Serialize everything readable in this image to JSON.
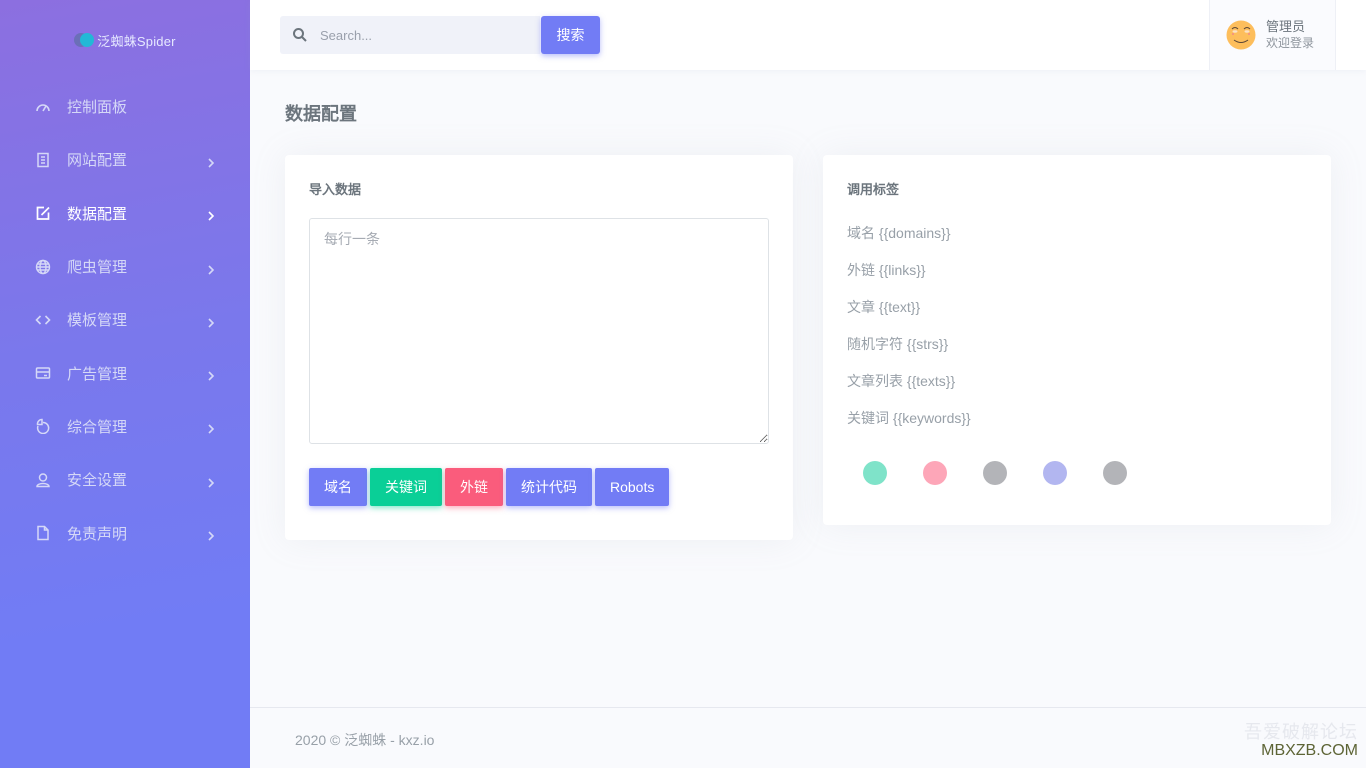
{
  "brand": {
    "name": "泛蜘蛛Spider"
  },
  "sidebar": {
    "items": [
      {
        "label": "控制面板",
        "icon": "speedometer-icon",
        "has_chevron": false,
        "active": false
      },
      {
        "label": "网站配置",
        "icon": "document-list-icon",
        "has_chevron": true,
        "active": false
      },
      {
        "label": "数据配置",
        "icon": "edit-icon",
        "has_chevron": true,
        "active": true
      },
      {
        "label": "爬虫管理",
        "icon": "globe-icon",
        "has_chevron": true,
        "active": false
      },
      {
        "label": "模板管理",
        "icon": "code-icon",
        "has_chevron": true,
        "active": false
      },
      {
        "label": "广告管理",
        "icon": "card-icon",
        "has_chevron": true,
        "active": false
      },
      {
        "label": "综合管理",
        "icon": "pie-chart-icon",
        "has_chevron": true,
        "active": false
      },
      {
        "label": "安全设置",
        "icon": "user-icon",
        "has_chevron": true,
        "active": false
      },
      {
        "label": "免责声明",
        "icon": "file-icon",
        "has_chevron": true,
        "active": false
      }
    ]
  },
  "topbar": {
    "search": {
      "placeholder": "Search...",
      "value": "",
      "button_label": "搜索"
    },
    "user": {
      "name": "管理员",
      "subtitle": "欢迎登录"
    }
  },
  "page": {
    "title": "数据配置"
  },
  "import_card": {
    "title": "导入数据",
    "textarea_placeholder": "每行一条",
    "textarea_value": "",
    "buttons": [
      {
        "label": "域名",
        "variant": "primary"
      },
      {
        "label": "关键词",
        "variant": "success"
      },
      {
        "label": "外链",
        "variant": "danger"
      },
      {
        "label": "统计代码",
        "variant": "primary"
      },
      {
        "label": "Robots",
        "variant": "primary"
      }
    ]
  },
  "tags_card": {
    "title": "调用标签",
    "items": [
      "域名 {{domains}}",
      "外链 {{links}}",
      "文章 {{text}}",
      "随机字符 {{strs}}",
      "文章列表 {{texts}}",
      "关键词 {{keywords}}"
    ],
    "dots": [
      "#7fe3c9",
      "#fda6b8",
      "#b3b4b8",
      "#b2b6f0",
      "#b3b4b8"
    ]
  },
  "footer": {
    "text": "2020 © 泛蜘蛛 - kxz.io"
  },
  "watermark": {
    "line1": "吾爱破解论坛",
    "line2": "MBXZB.COM"
  },
  "colors": {
    "primary": "#727cf5",
    "success": "#0acf97",
    "danger": "#fa5c7c"
  }
}
